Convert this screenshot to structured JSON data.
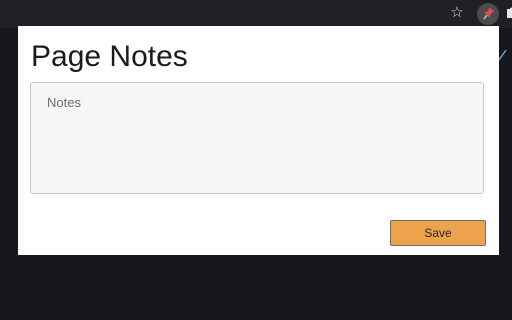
{
  "browser": {
    "icons": [
      "star-icon",
      "pin-icon",
      "puzzle-icon"
    ],
    "pin_button_color": "#4a4c50"
  },
  "popup": {
    "title": "Page Notes",
    "notes_placeholder": "Notes",
    "notes_value": "",
    "save_label": "Save"
  },
  "colors": {
    "background": "#17181c",
    "popup_bg": "#ffffff",
    "textarea_bg": "#f6f6f6",
    "save_button_bg": "#eda24c",
    "pin_icon": "#e24b4b"
  }
}
